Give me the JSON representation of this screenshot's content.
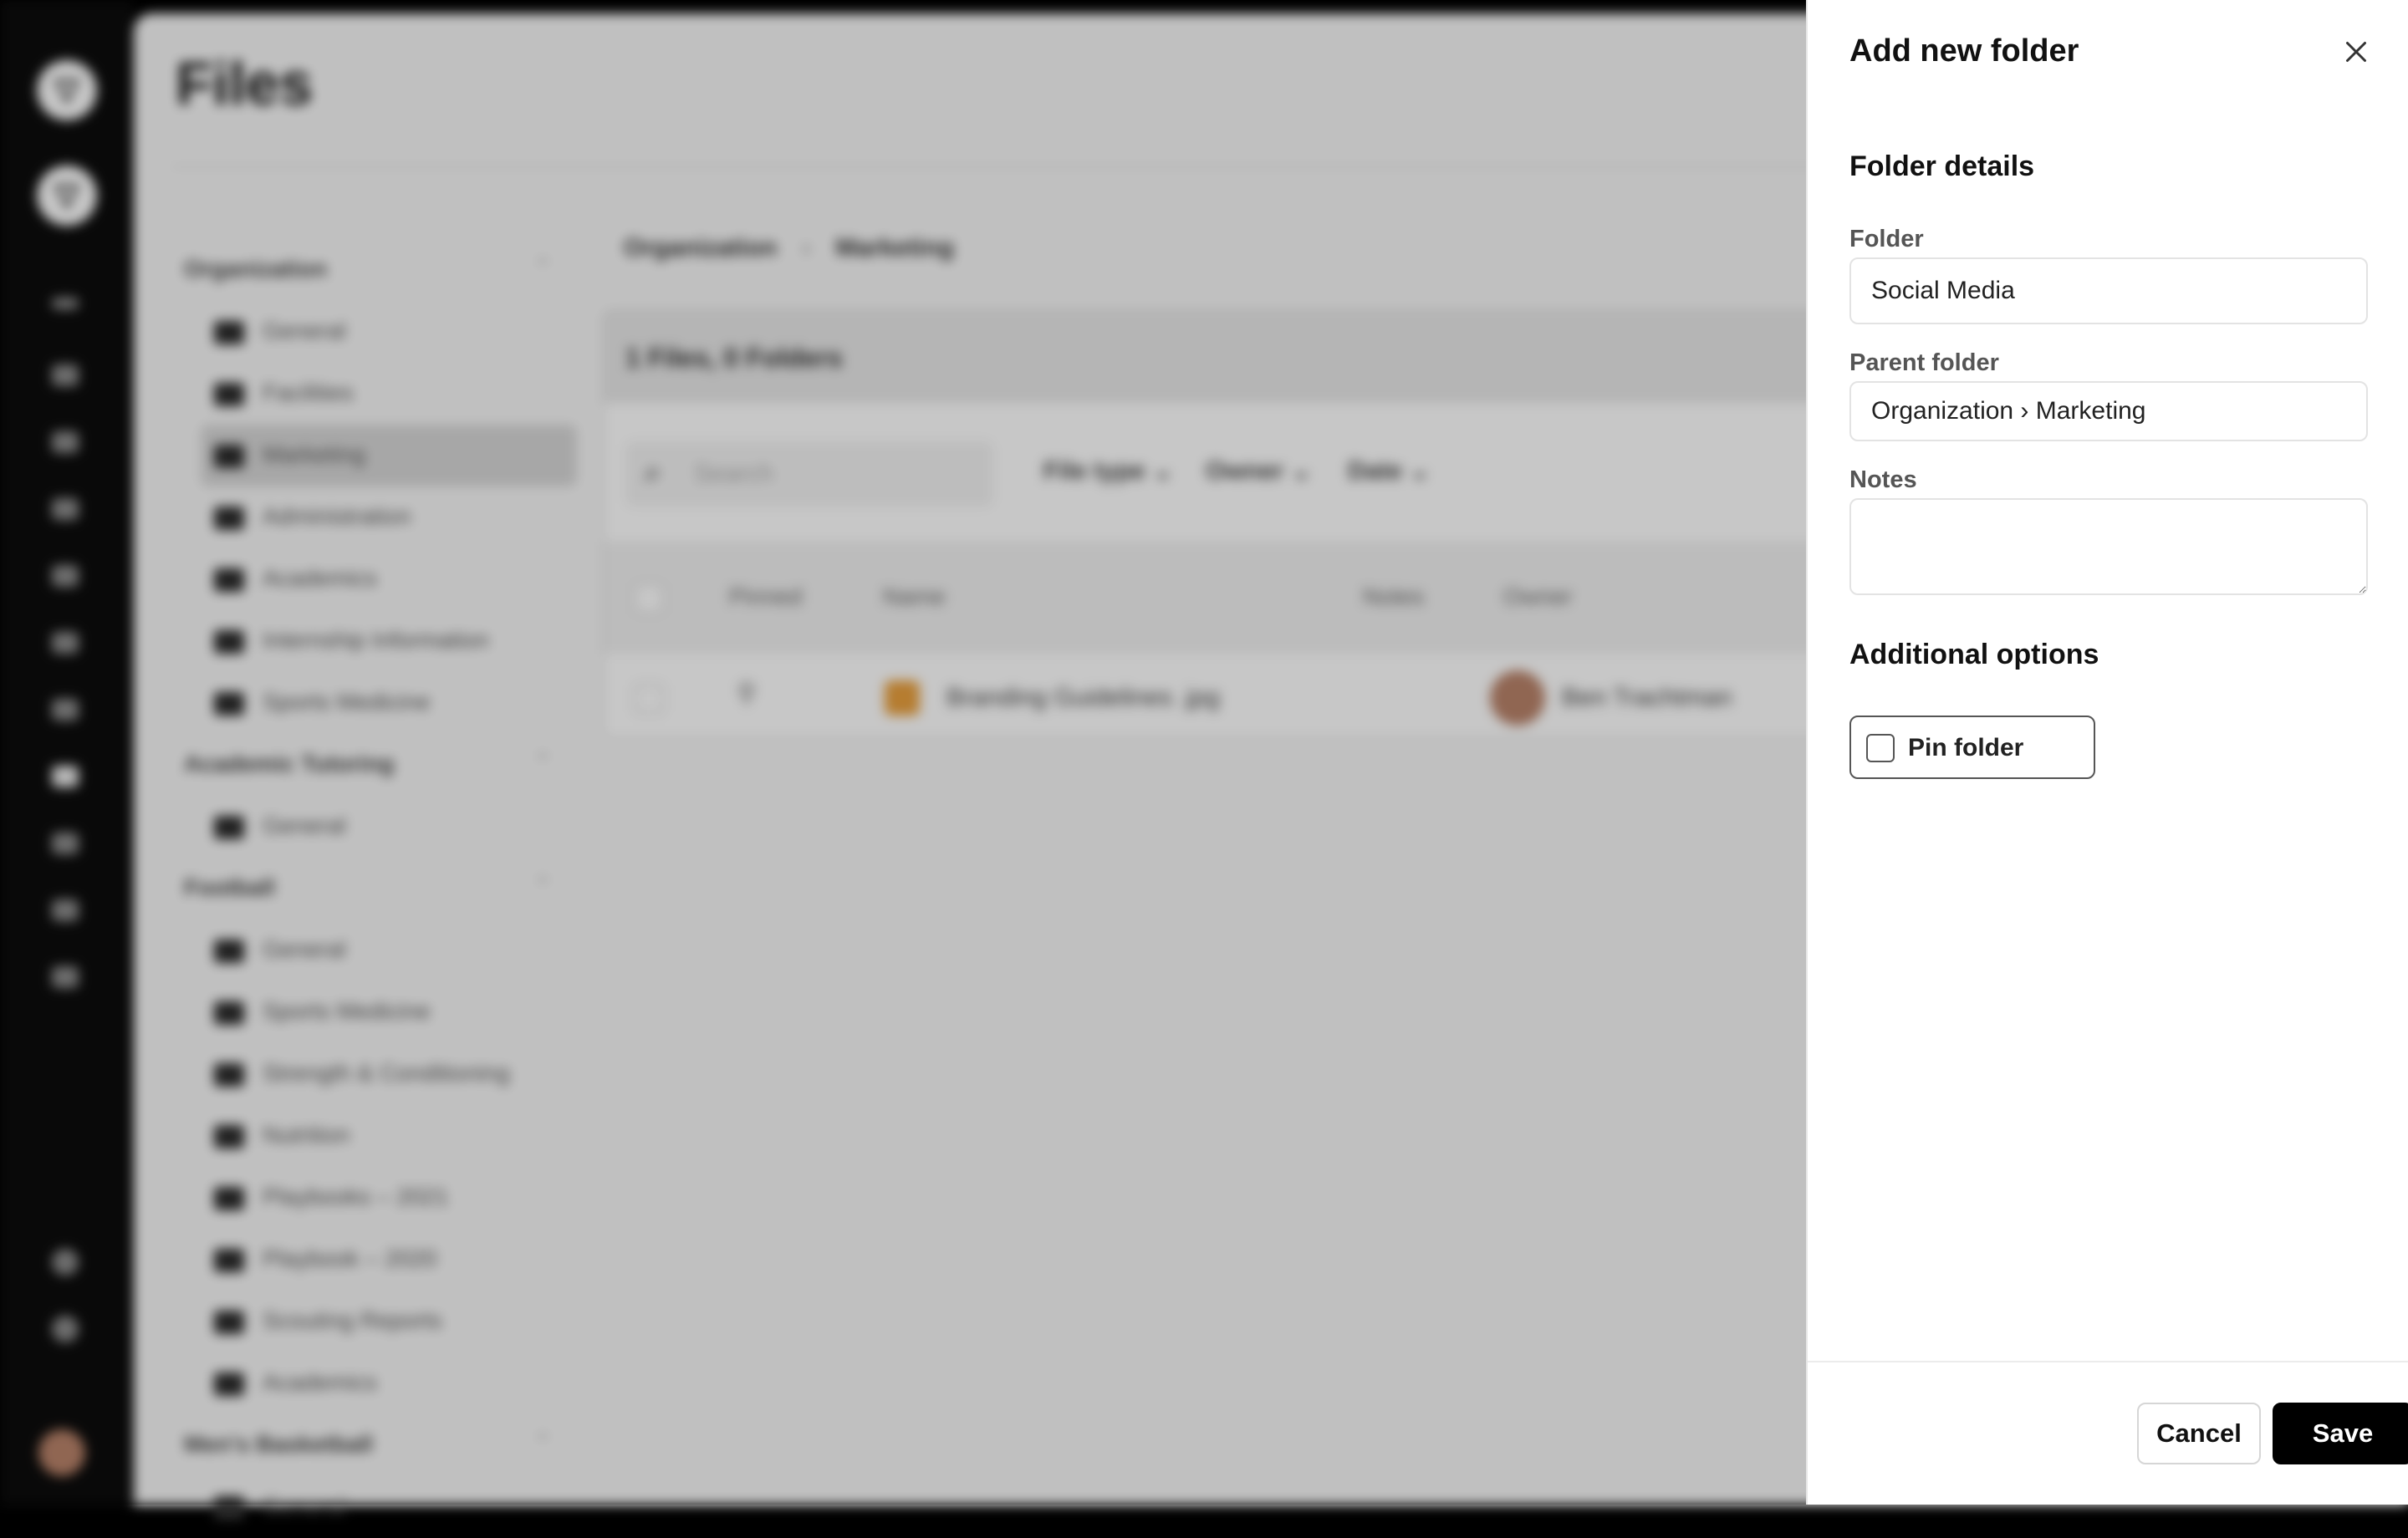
{
  "app": {
    "page_title": "Files",
    "tree": [
      {
        "title": "Organization",
        "items": [
          "General",
          "Facilities",
          "Marketing",
          "Administration",
          "Academics",
          "Internship Information",
          "Sports Medicine"
        ],
        "selected": 2
      },
      {
        "title": "Academic Tutoring",
        "items": [
          "General"
        ]
      },
      {
        "title": "Football",
        "items": [
          "General",
          "Sports Medicine",
          "Strength & Conditioning",
          "Nutrition",
          "Playbooks – 2021",
          "Playbook – 2020",
          "Scouting Reports",
          "Academics"
        ]
      },
      {
        "title": "Men's Basketball",
        "items": [
          "General"
        ]
      }
    ],
    "breadcrumb": [
      "Organization",
      "Marketing"
    ],
    "summary": "1 Files, 0 Folders",
    "search_placeholder": "Search",
    "filters": [
      "File type",
      "Owner",
      "Date"
    ],
    "columns": {
      "pinned": "Pinned",
      "name": "Name",
      "notes": "Notes",
      "owner": "Owner"
    },
    "row": {
      "name": "Branding Guidelines .jpg",
      "owner": "Ben Trachtman"
    }
  },
  "drawer": {
    "title": "Add new folder",
    "details_heading": "Folder details",
    "folder_label": "Folder",
    "folder_value": "Social Media",
    "parent_label": "Parent folder",
    "parent_value": "Organization › Marketing",
    "notes_label": "Notes",
    "notes_value": "",
    "options_heading": "Additional options",
    "pin_label": "Pin folder",
    "pin_checked": false,
    "cancel_label": "Cancel",
    "save_label": "Save"
  },
  "colors": {
    "accent": "#000000",
    "overlay": "rgba(0,0,0,0.22)",
    "rail": "#0c0c0c"
  },
  "icons": {
    "close": "close-icon",
    "search": "search-icon",
    "folder": "folder-icon"
  }
}
